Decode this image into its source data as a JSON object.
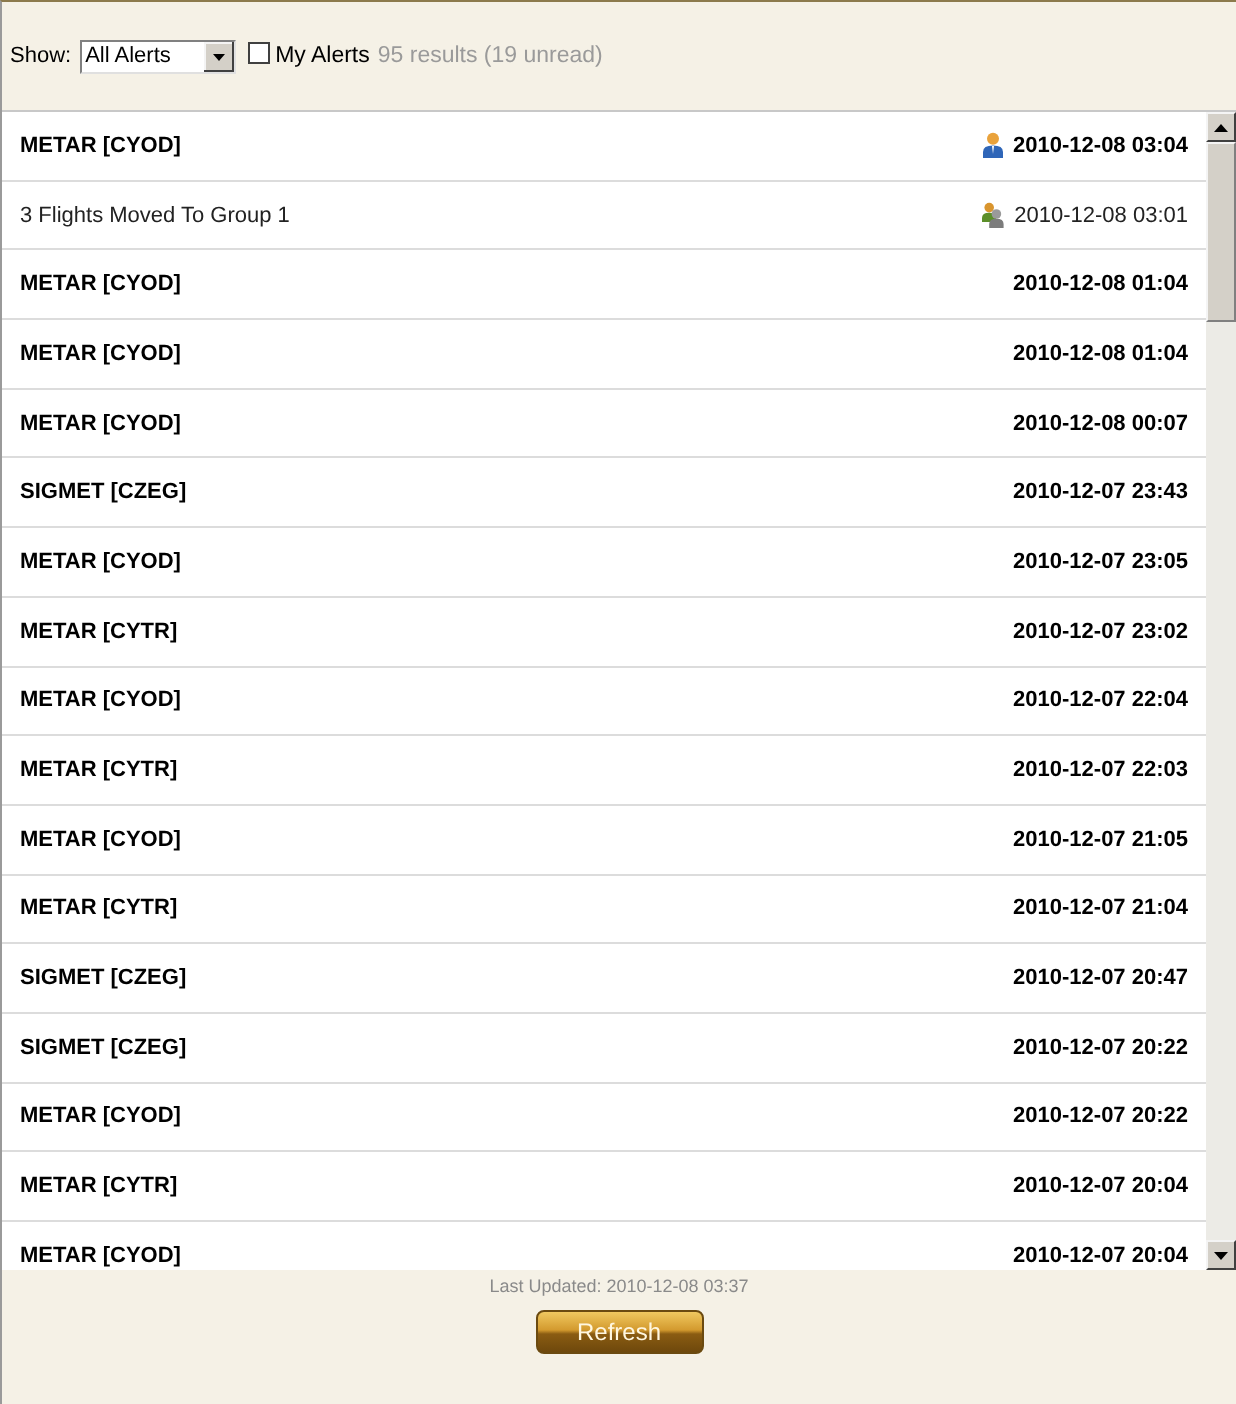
{
  "toolbar": {
    "show_label": "Show:",
    "filter": {
      "value": "All Alerts"
    },
    "my_alerts": {
      "label": "My Alerts",
      "checked": false
    },
    "summary": "95 results (19 unread)"
  },
  "alerts": [
    {
      "title": "METAR [CYOD]",
      "time": "2010-12-08 03:04",
      "unread": true,
      "kind": "personal"
    },
    {
      "title": "3 Flights Moved To Group 1",
      "time": "2010-12-08 03:01",
      "unread": false,
      "kind": "group"
    },
    {
      "title": "METAR [CYOD]",
      "time": "2010-12-08 01:04",
      "unread": true,
      "kind": "system"
    },
    {
      "title": "METAR [CYOD]",
      "time": "2010-12-08 01:04",
      "unread": true,
      "kind": "system"
    },
    {
      "title": "METAR [CYOD]",
      "time": "2010-12-08 00:07",
      "unread": true,
      "kind": "system"
    },
    {
      "title": "SIGMET [CZEG]",
      "time": "2010-12-07 23:43",
      "unread": true,
      "kind": "system"
    },
    {
      "title": "METAR [CYOD]",
      "time": "2010-12-07 23:05",
      "unread": true,
      "kind": "system"
    },
    {
      "title": "METAR [CYTR]",
      "time": "2010-12-07 23:02",
      "unread": true,
      "kind": "system"
    },
    {
      "title": "METAR [CYOD]",
      "time": "2010-12-07 22:04",
      "unread": true,
      "kind": "system"
    },
    {
      "title": "METAR [CYTR]",
      "time": "2010-12-07 22:03",
      "unread": true,
      "kind": "system"
    },
    {
      "title": "METAR [CYOD]",
      "time": "2010-12-07 21:05",
      "unread": true,
      "kind": "system"
    },
    {
      "title": "METAR [CYTR]",
      "time": "2010-12-07 21:04",
      "unread": true,
      "kind": "system"
    },
    {
      "title": "SIGMET [CZEG]",
      "time": "2010-12-07 20:47",
      "unread": true,
      "kind": "system"
    },
    {
      "title": "SIGMET [CZEG]",
      "time": "2010-12-07 20:22",
      "unread": true,
      "kind": "system"
    },
    {
      "title": "METAR [CYOD]",
      "time": "2010-12-07 20:22",
      "unread": true,
      "kind": "system"
    },
    {
      "title": "METAR [CYTR]",
      "time": "2010-12-07 20:04",
      "unread": true,
      "kind": "system"
    },
    {
      "title": "METAR [CYOD]",
      "time": "2010-12-07 20:04",
      "unread": true,
      "kind": "system"
    }
  ],
  "footer": {
    "last_updated": "Last Updated: 2010-12-08 03:37",
    "refresh_button": "Refresh"
  }
}
